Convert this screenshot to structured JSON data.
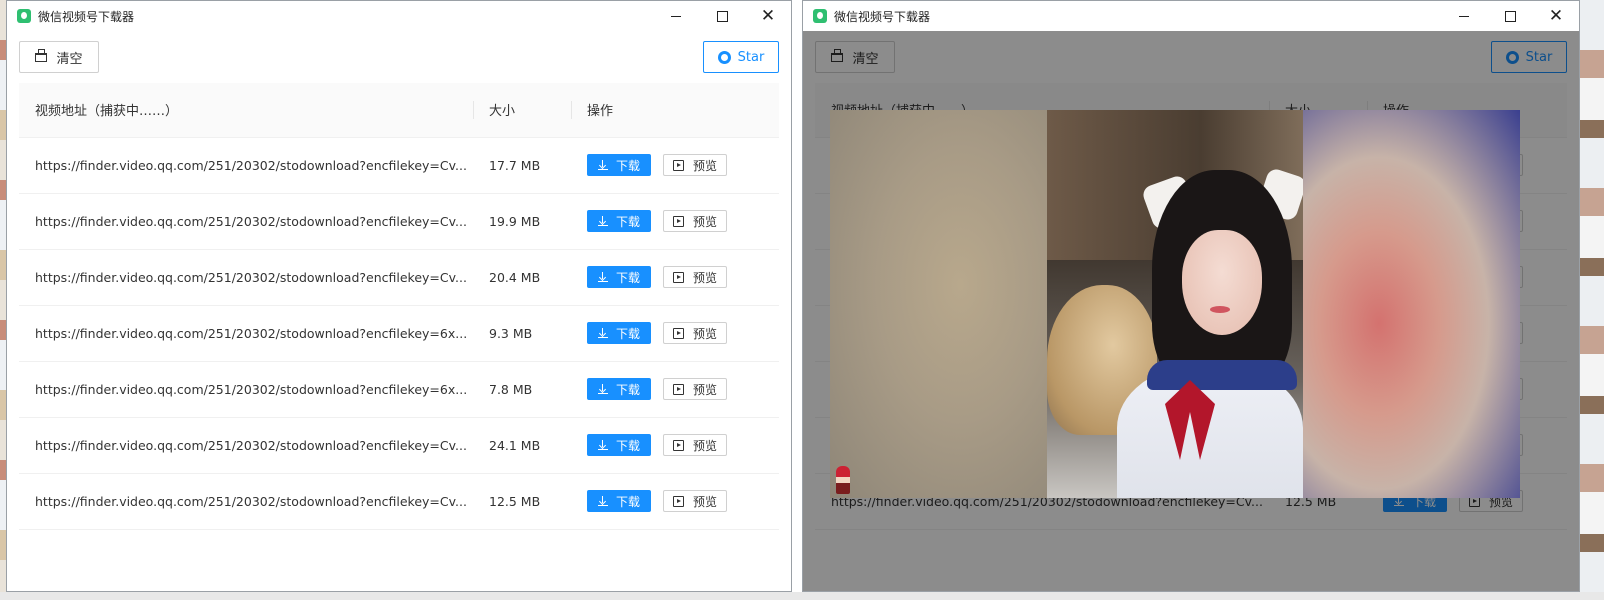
{
  "app": {
    "title": "微信视频号下载器"
  },
  "toolbar": {
    "clear_label": "清空",
    "star_label": "Star"
  },
  "table": {
    "headers": {
      "url": "视频地址（捕获中……）",
      "size": "大小",
      "ops": "操作"
    },
    "download_label": "下载",
    "preview_label": "预览",
    "rows": [
      {
        "url": "https://finder.video.qq.com/251/20302/stodownload?encfilekey=Cv...",
        "size": "17.7 MB"
      },
      {
        "url": "https://finder.video.qq.com/251/20302/stodownload?encfilekey=Cv...",
        "size": "19.9 MB"
      },
      {
        "url": "https://finder.video.qq.com/251/20302/stodownload?encfilekey=Cv...",
        "size": "20.4 MB"
      },
      {
        "url": "https://finder.video.qq.com/251/20302/stodownload?encfilekey=6x...",
        "size": "9.3 MB"
      },
      {
        "url": "https://finder.video.qq.com/251/20302/stodownload?encfilekey=6x...",
        "size": "7.8 MB"
      },
      {
        "url": "https://finder.video.qq.com/251/20302/stodownload?encfilekey=Cv...",
        "size": "24.1 MB"
      },
      {
        "url": "https://finder.video.qq.com/251/20302/stodownload?encfilekey=Cv...",
        "size": "12.5 MB"
      }
    ]
  },
  "colors": {
    "primary": "#1890ff",
    "header_bg": "#fafafa",
    "mask": "rgba(0,0,0,0.45)"
  }
}
